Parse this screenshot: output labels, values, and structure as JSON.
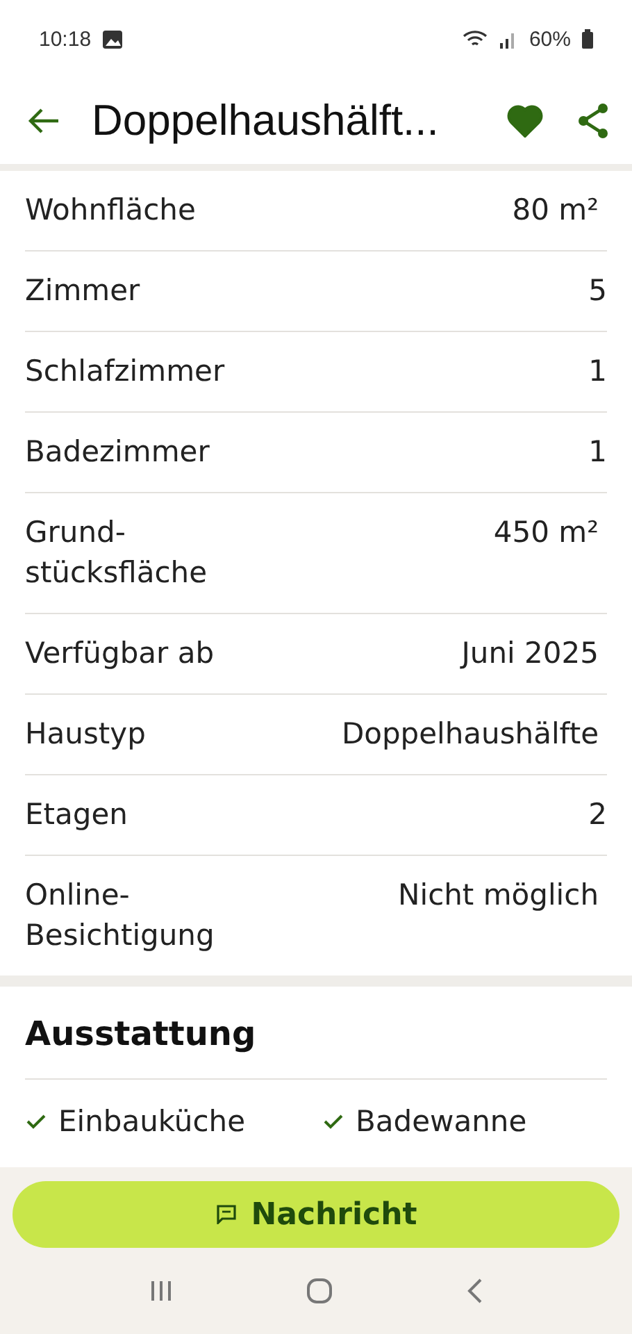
{
  "status_bar": {
    "time": "10:18",
    "battery": "60%"
  },
  "app_bar": {
    "title": "Doppelhaushälft...",
    "favorite": true
  },
  "details": [
    {
      "label": "Wohnfläche",
      "value": "80 m²"
    },
    {
      "label": "Zimmer",
      "value": "5"
    },
    {
      "label": "Schlafzimmer",
      "value": "1"
    },
    {
      "label": "Badezimmer",
      "value": "1"
    },
    {
      "label": "Grund-\nstücksfläche",
      "value": "450 m²"
    },
    {
      "label": "Verfügbar ab",
      "value": "Juni 2025"
    },
    {
      "label": "Haustyp",
      "value": "Doppelhaushälfte"
    },
    {
      "label": "Etagen",
      "value": "2"
    },
    {
      "label": "Online-\nBesichtigung",
      "value": "Nicht möglich"
    }
  ],
  "features": {
    "title": "Ausstattung",
    "items": [
      "Einbauküche",
      "Badewanne"
    ]
  },
  "action_button": {
    "label": "Nachricht"
  }
}
